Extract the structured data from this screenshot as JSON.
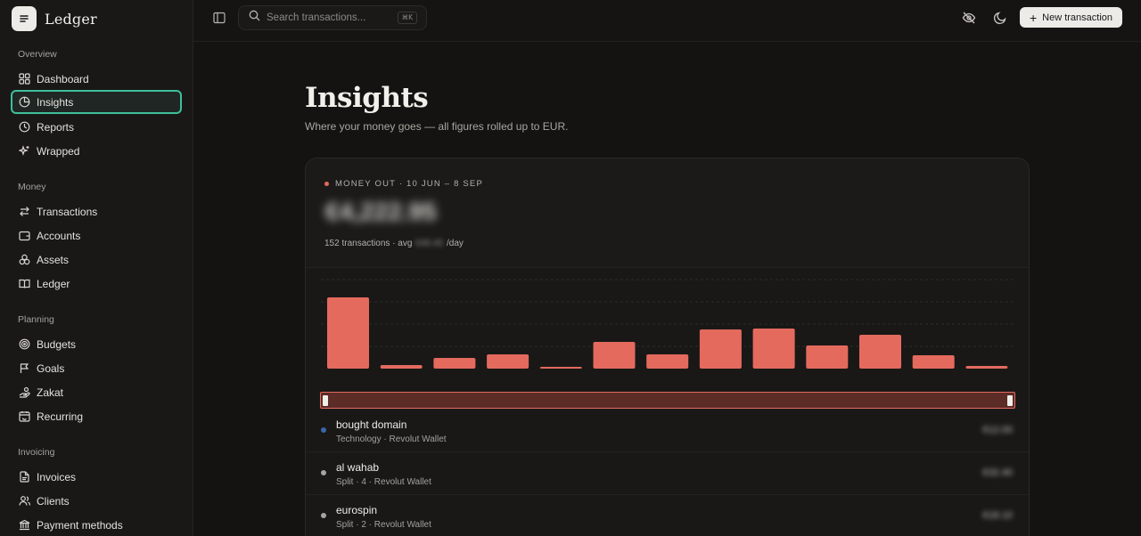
{
  "brand": {
    "name": "Ledger"
  },
  "sidebar": {
    "sections": [
      {
        "title": "Overview",
        "items": [
          {
            "label": "Dashboard",
            "icon": "dashboard-icon"
          },
          {
            "label": "Insights",
            "icon": "pie-chart-icon",
            "active": true
          },
          {
            "label": "Reports",
            "icon": "clock-chart-icon"
          },
          {
            "label": "Wrapped",
            "icon": "sparkles-icon"
          }
        ]
      },
      {
        "title": "Money",
        "items": [
          {
            "label": "Transactions",
            "icon": "arrows-swap-icon"
          },
          {
            "label": "Accounts",
            "icon": "wallet-icon"
          },
          {
            "label": "Assets",
            "icon": "coins-icon"
          },
          {
            "label": "Ledger",
            "icon": "book-open-icon"
          }
        ]
      },
      {
        "title": "Planning",
        "items": [
          {
            "label": "Budgets",
            "icon": "target-icon"
          },
          {
            "label": "Goals",
            "icon": "flag-icon"
          },
          {
            "label": "Zakat",
            "icon": "hand-coins-icon"
          },
          {
            "label": "Recurring",
            "icon": "calendar-repeat-icon"
          }
        ]
      },
      {
        "title": "Invoicing",
        "items": [
          {
            "label": "Invoices",
            "icon": "file-text-icon"
          },
          {
            "label": "Clients",
            "icon": "users-icon"
          },
          {
            "label": "Payment methods",
            "icon": "bank-icon"
          }
        ]
      }
    ]
  },
  "topbar": {
    "search_placeholder": "Search transactions...",
    "search_shortcut": "⌘K",
    "new_button": "New transaction"
  },
  "page": {
    "title": "Insights",
    "subtitle": "Where your money goes — all figures rolled up to EUR."
  },
  "summary": {
    "kicker": "MONEY OUT · 10 JUN – 8 SEP",
    "amount": "€4,222.95",
    "transactions_text": "152 transactions · avg",
    "avg_value": "€46.40",
    "per_day": "/day"
  },
  "colors": {
    "accent": "#e46a5e",
    "active_nav": "#3fbf9b"
  },
  "chart_data": {
    "type": "bar",
    "categories": [
      "",
      "",
      "",
      "",
      "",
      "",
      "",
      "",
      "",
      "",
      "",
      "",
      "",
      ""
    ],
    "values": [
      80,
      4,
      12,
      16,
      2,
      30,
      16,
      44,
      45,
      26,
      38,
      15,
      3,
      0
    ],
    "ylim": [
      0,
      100
    ],
    "grid": true
  },
  "transactions": [
    {
      "name": "bought domain",
      "sub": "Technology · Revolut Wallet",
      "amount": "€12.00",
      "dot": "#3a66a8"
    },
    {
      "name": "al wahab",
      "sub": "Split · 4 · Revolut Wallet",
      "amount": "€32.40",
      "dot": "#a8a5a0"
    },
    {
      "name": "eurospin",
      "sub": "Split · 2 · Revolut Wallet",
      "amount": "€18.10",
      "dot": "#a8a5a0"
    }
  ]
}
